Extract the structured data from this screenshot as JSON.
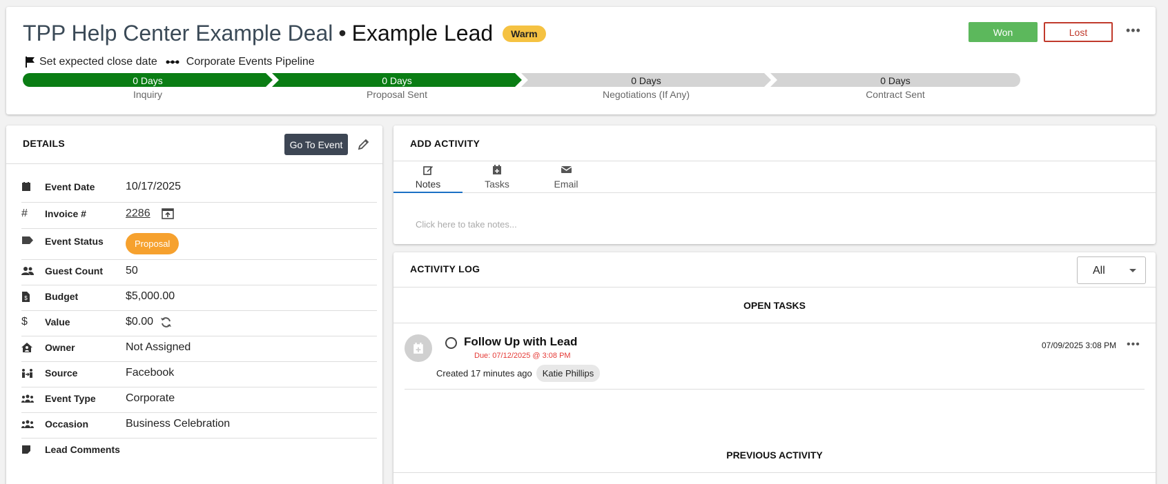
{
  "header": {
    "deal_name": "TPP Help Center Example Deal",
    "separator": "•",
    "lead_name": "Example Lead",
    "temperature": "Warm",
    "set_close_date": "Set expected close date",
    "pipeline_name": "Corporate Events Pipeline",
    "won_label": "Won",
    "lost_label": "Lost",
    "more": "•••"
  },
  "pipeline": {
    "stages": [
      {
        "days": "0 Days",
        "name": "Inquiry",
        "complete": true
      },
      {
        "days": "0 Days",
        "name": "Proposal Sent",
        "complete": true
      },
      {
        "days": "0 Days",
        "name": "Negotiations (If Any)",
        "complete": false
      },
      {
        "days": "0 Days",
        "name": "Contract Sent",
        "complete": false
      }
    ],
    "colors": {
      "complete": "#0a7d14",
      "incomplete": "#d4d4d4"
    }
  },
  "details": {
    "title": "DETAILS",
    "go_to_event": "Go To Event",
    "rows": [
      {
        "icon": "calendar-icon",
        "label": "Event Date",
        "value": "10/17/2025"
      },
      {
        "icon": "hash-icon",
        "label": "Invoice #",
        "value": "2286"
      },
      {
        "icon": "tag-icon",
        "label": "Event Status",
        "value": "Proposal"
      },
      {
        "icon": "users-icon",
        "label": "Guest Count",
        "value": "50"
      },
      {
        "icon": "budget-icon",
        "label": "Budget",
        "value": "$5,000.00"
      },
      {
        "icon": "dollar-icon",
        "label": "Value",
        "value": "$0.00"
      },
      {
        "icon": "house-user-icon",
        "label": "Owner",
        "value": "Not Assigned"
      },
      {
        "icon": "source-icon",
        "label": "Source",
        "value": "Facebook"
      },
      {
        "icon": "group-icon",
        "label": "Event Type",
        "value": "Corporate"
      },
      {
        "icon": "group-icon",
        "label": "Occasion",
        "value": "Business Celebration"
      },
      {
        "icon": "sticky-note-icon",
        "label": "Lead Comments",
        "value": ""
      }
    ]
  },
  "activity": {
    "title": "ADD ACTIVITY",
    "tabs": [
      {
        "label": "Notes",
        "icon": "edit-icon",
        "active": true
      },
      {
        "label": "Tasks",
        "icon": "calendar-plus-icon",
        "active": false
      },
      {
        "label": "Email",
        "icon": "envelope-icon",
        "active": false
      }
    ],
    "notes_placeholder": "Click here to take notes..."
  },
  "log": {
    "title": "ACTIVITY LOG",
    "filter": "All",
    "open_tasks_title": "OPEN TASKS",
    "task": {
      "title": "Follow Up with Lead",
      "due": "Due: 07/12/2025 @ 3:08 PM",
      "created": "Created 17 minutes ago",
      "assignee": "Katie Phillips",
      "date": "07/09/2025 3:08 PM",
      "more": "•••"
    },
    "previous_title": "PREVIOUS ACTIVITY"
  }
}
